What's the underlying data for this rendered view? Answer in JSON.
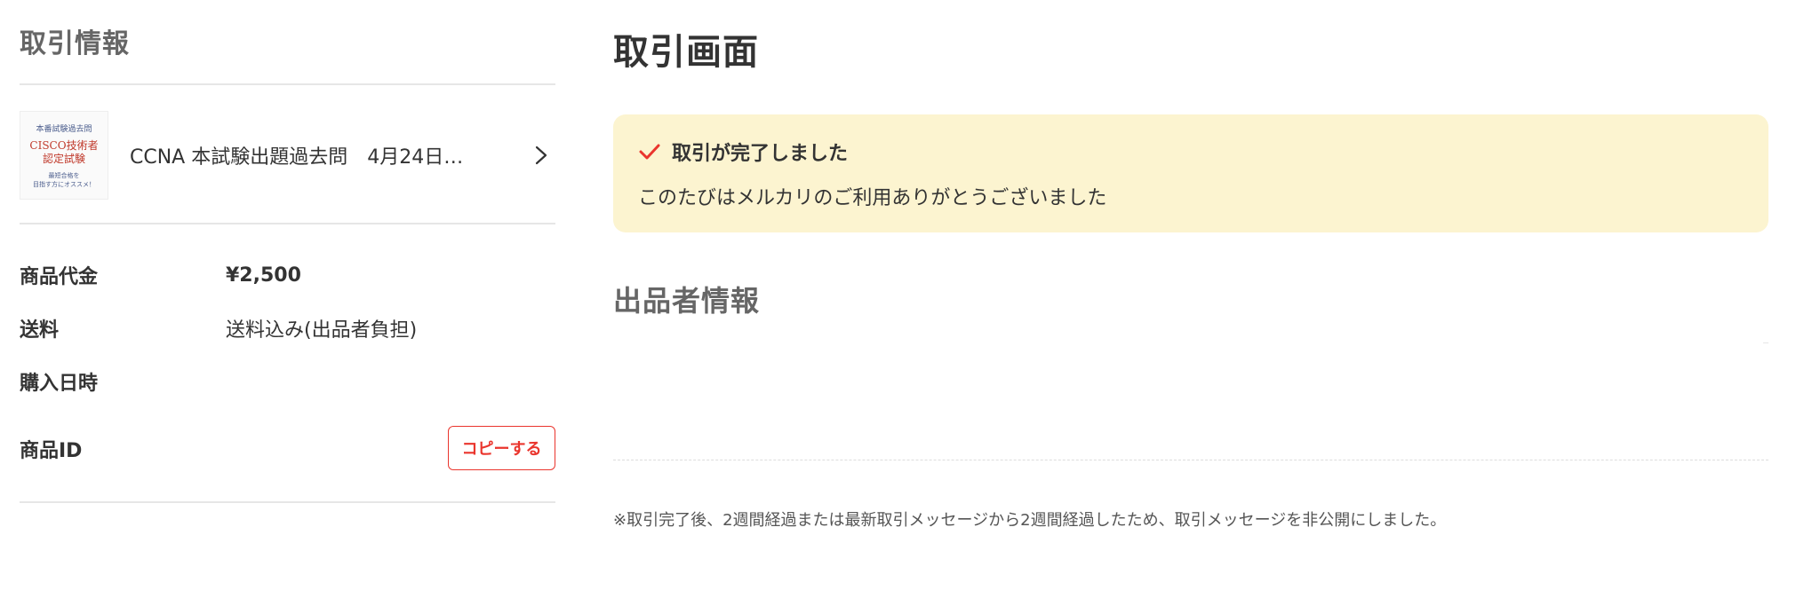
{
  "sidebar": {
    "title": "取引情報",
    "product": {
      "name": "CCNA 本試験出題過去問　4月24日…",
      "thumbnail_lines": [
        "本番試験過去問",
        "CISCO技術者\n認定試験",
        "最短合格を\n目指す方にオススメ！"
      ]
    },
    "rows": [
      {
        "label": "商品代金",
        "value": "¥2,500"
      },
      {
        "label": "送料",
        "value": "送料込み(出品者負担)"
      },
      {
        "label": "購入日時",
        "value": ""
      },
      {
        "label": "商品ID",
        "value": ""
      }
    ],
    "copy_button": "コピーする"
  },
  "main": {
    "title": "取引画面",
    "notice": {
      "heading": "取引が完了しました",
      "message": "このたびはメルカリのご利用ありがとうございました"
    },
    "seller_title": "出品者情報",
    "footnote": "※取引完了後、2週間経過または最新取引メッセージから2週間経過したため、取引メッセージを非公開にしました。"
  },
  "colors": {
    "accent": "#ea352d",
    "notice_bg": "#fcf4d0",
    "check": "#ea352d"
  }
}
